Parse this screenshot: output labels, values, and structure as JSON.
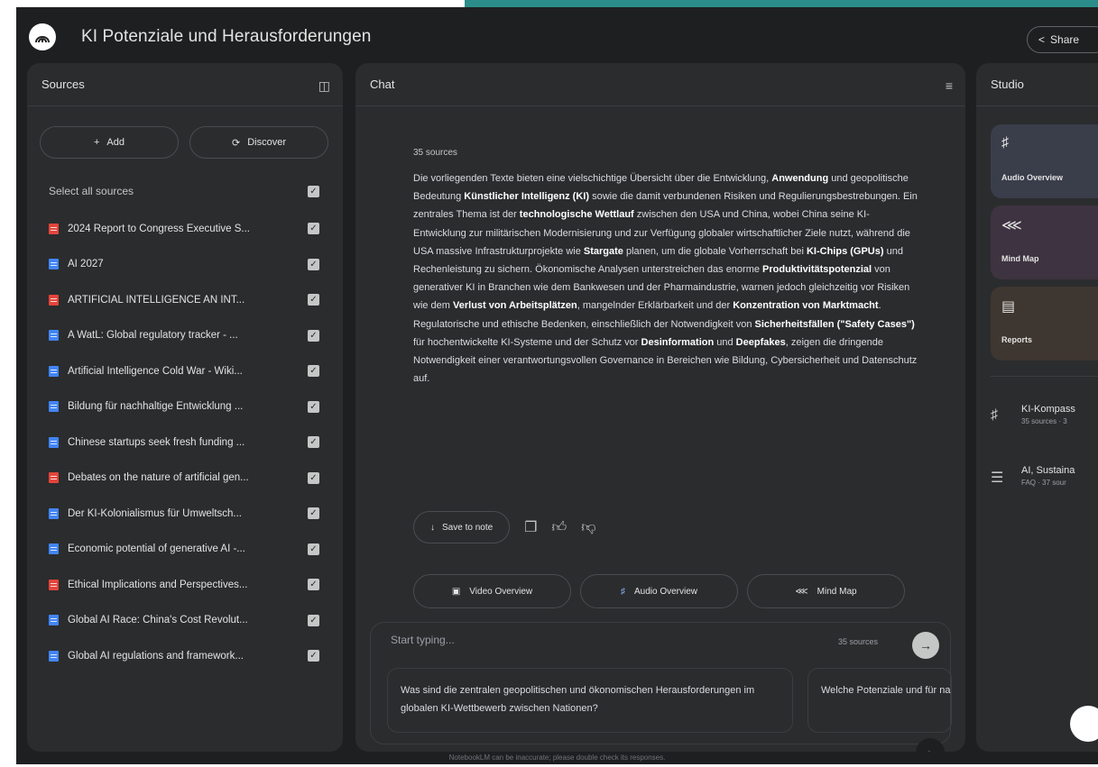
{
  "header": {
    "title": "KI Potenziale und Herausforderungen",
    "share_label": "Share"
  },
  "sources": {
    "title": "Sources",
    "add_label": "Add",
    "discover_label": "Discover",
    "select_all_label": "Select all sources",
    "items": [
      {
        "label": "2024 Report to Congress Executive S...",
        "color": "#e2453b"
      },
      {
        "label": "AI 2027",
        "color": "#4285f4"
      },
      {
        "label": "ARTIFICIAL INTELLIGENCE AN INT...",
        "color": "#e2453b"
      },
      {
        "label": "A WatL: Global regulatory tracker - ...",
        "color": "#4285f4"
      },
      {
        "label": "Artificial Intelligence Cold War - Wiki...",
        "color": "#4285f4"
      },
      {
        "label": "Bildung für nachhaltige Entwicklung ...",
        "color": "#4285f4"
      },
      {
        "label": "Chinese startups seek fresh funding ...",
        "color": "#4285f4"
      },
      {
        "label": "Debates on the nature of artificial gen...",
        "color": "#e2453b"
      },
      {
        "label": "Der KI-Kolonialismus für Umweltsch...",
        "color": "#4285f4"
      },
      {
        "label": "Economic potential of generative AI -...",
        "color": "#4285f4"
      },
      {
        "label": "Ethical Implications and Perspectives...",
        "color": "#e2453b"
      },
      {
        "label": "Global AI Race: China's Cost Revolut...",
        "color": "#4285f4"
      },
      {
        "label": "Global AI regulations and framework...",
        "color": "#4285f4"
      }
    ]
  },
  "chat": {
    "title": "Chat",
    "source_count": "35 sources",
    "summary_parts": [
      {
        "t": "Die vorliegenden Texte bieten eine vielschichtige Übersicht über die Entwicklung, ",
        "b": false
      },
      {
        "t": "Anwendung",
        "b": true
      },
      {
        "t": " und geopolitische Bedeutung ",
        "b": false
      },
      {
        "t": "Künstlicher Intelligenz (KI)",
        "b": true
      },
      {
        "t": " sowie die damit verbundenen Risiken und Regulierungsbestrebungen. Ein zentrales Thema ist der ",
        "b": false
      },
      {
        "t": "technologische Wettlauf",
        "b": true
      },
      {
        "t": " zwischen den USA und China, wobei China seine KI-Entwicklung zur militärischen Modernisierung und zur Verfügung globaler wirtschaftlicher Ziele nutzt, während die USA massive Infrastrukturprojekte wie ",
        "b": false
      },
      {
        "t": "Stargate",
        "b": true
      },
      {
        "t": " planen, um die globale Vorherrschaft bei ",
        "b": false
      },
      {
        "t": "KI-Chips (GPUs)",
        "b": true
      },
      {
        "t": " und Rechenleistung zu sichern. Ökonomische Analysen unterstreichen das enorme ",
        "b": false
      },
      {
        "t": "Produktivitätspotenzial",
        "b": true
      },
      {
        "t": " von generativer KI in Branchen wie dem Bankwesen und der Pharmaindustrie, warnen jedoch gleichzeitig vor Risiken wie dem ",
        "b": false
      },
      {
        "t": "Verlust von Arbeitsplätzen",
        "b": true
      },
      {
        "t": ", mangelnder Erklärbarkeit und der ",
        "b": false
      },
      {
        "t": "Konzentration von Marktmacht",
        "b": true
      },
      {
        "t": ". Regulatorische und ethische Bedenken, einschließlich der Notwendigkeit von ",
        "b": false
      },
      {
        "t": "Sicherheitsfällen (\"Safety Cases\")",
        "b": true
      },
      {
        "t": " für hochentwickelte KI-Systeme und der Schutz vor ",
        "b": false
      },
      {
        "t": "Desinformation",
        "b": true
      },
      {
        "t": " und ",
        "b": false
      },
      {
        "t": "Deepfakes",
        "b": true
      },
      {
        "t": ", zeigen die dringende Notwendigkeit einer verantwortungsvollen Governance in Bereichen wie Bildung, Cybersicherheit und Datenschutz auf.",
        "b": false
      }
    ],
    "save_note_label": "Save to note",
    "overview_buttons": [
      {
        "label": "Video Overview",
        "icon": "video-icon"
      },
      {
        "label": "Audio Overview",
        "icon": "audio-wave-icon"
      },
      {
        "label": "Mind Map",
        "icon": "mind-map-icon"
      }
    ],
    "input_placeholder": "Start typing...",
    "input_source_count": "35 sources",
    "suggestions": [
      "Was sind die zentralen geopolitischen und ökonomischen Herausforderungen im globalen KI-Wettbewerb zwischen Nationen?",
      "Welche Potenziale und für nachhaltige"
    ]
  },
  "studio": {
    "title": "Studio",
    "cards": [
      {
        "label": "Audio Overview",
        "icon": "audio-wave-icon"
      },
      {
        "label": "Mind Map",
        "icon": "mind-map-icon"
      },
      {
        "label": "Reports",
        "icon": "report-icon"
      }
    ],
    "notes": [
      {
        "title": "KI-Kompass",
        "subtitle": "35 sources · 3"
      },
      {
        "title": "AI, Sustaina",
        "subtitle": "FAQ · 37 sour"
      }
    ]
  },
  "footer": {
    "disclaimer": "NotebookLM can be inaccurate; please double check its responses."
  }
}
